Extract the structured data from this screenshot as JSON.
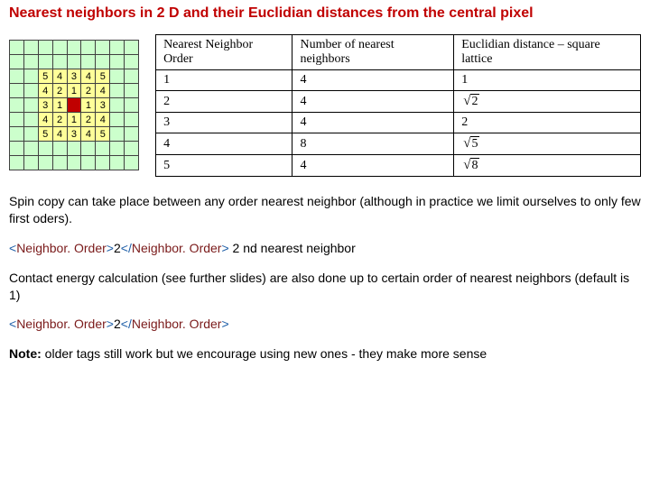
{
  "title": "Nearest neighbors in 2 D and their Euclidian distances from the central pixel",
  "lattice": {
    "rows": [
      [
        "",
        "",
        "",
        "",
        "",
        "",
        "",
        "",
        ""
      ],
      [
        "",
        "",
        "",
        "",
        "",
        "",
        "",
        "",
        ""
      ],
      [
        "",
        "",
        "5",
        "4",
        "3",
        "4",
        "5",
        "",
        ""
      ],
      [
        "",
        "",
        "4",
        "2",
        "1",
        "2",
        "4",
        "",
        ""
      ],
      [
        "",
        "",
        "3",
        "1",
        "",
        "1",
        "3",
        "",
        ""
      ],
      [
        "",
        "",
        "4",
        "2",
        "1",
        "2",
        "4",
        "",
        ""
      ],
      [
        "",
        "",
        "5",
        "4",
        "3",
        "4",
        "5",
        "",
        ""
      ],
      [
        "",
        "",
        "",
        "",
        "",
        "",
        "",
        "",
        ""
      ],
      [
        "",
        "",
        "",
        "",
        "",
        "",
        "",
        "",
        ""
      ]
    ],
    "center": {
      "r": 4,
      "c": 4
    }
  },
  "table": {
    "headers": [
      "Nearest Neighbor Order",
      "Number of nearest neighbors",
      "Euclidian distance – square lattice"
    ],
    "rows": [
      {
        "order": "1",
        "count": "4",
        "dist_plain": "1"
      },
      {
        "order": "2",
        "count": "4",
        "dist_sqrt": "2"
      },
      {
        "order": "3",
        "count": "4",
        "dist_plain": "2"
      },
      {
        "order": "4",
        "count": "8",
        "dist_sqrt": "5"
      },
      {
        "order": "5",
        "count": "4",
        "dist_sqrt": "8"
      }
    ]
  },
  "para1": "Spin copy can take place between any order nearest neighbor (although in practice we limit ourselves to only few first oders).",
  "xml": {
    "lt": "<",
    "gt": ">",
    "slash": "/",
    "tag": "Neighbor. Order",
    "val": "2"
  },
  "xml_suffix": " 2 nd nearest neighbor",
  "para2": "Contact energy calculation (see further slides) are also done up to certain order of nearest neighbors (default is 1)",
  "note_label": "Note:",
  "note_text": " older tags still work but we encourage using new ones - they make more sense",
  "chart_data": {
    "type": "table",
    "title": "Nearest neighbor orders on a 2D square lattice",
    "columns": [
      "Nearest Neighbor Order",
      "Number of nearest neighbors",
      "Euclidian distance"
    ],
    "rows": [
      [
        1,
        4,
        1
      ],
      [
        2,
        4,
        1.4142
      ],
      [
        3,
        4,
        2
      ],
      [
        4,
        8,
        2.2361
      ],
      [
        5,
        4,
        2.8284
      ]
    ],
    "distance_expr": [
      "1",
      "sqrt(2)",
      "2",
      "sqrt(5)",
      "sqrt(8)"
    ]
  }
}
